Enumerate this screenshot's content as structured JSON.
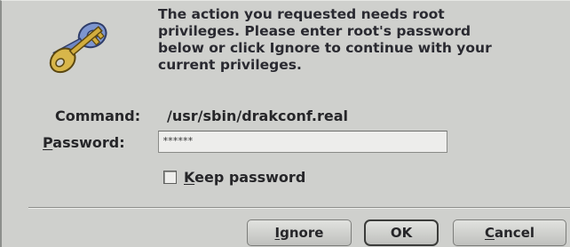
{
  "dialog": {
    "icon": "keys-icon",
    "message_lines": [
      "The action you requested needs root",
      "privileges. Please enter root's password",
      "below or click Ignore to continue with your",
      "current privileges."
    ],
    "command_label": "Command:",
    "command_value": "/usr/sbin/drakconf.real",
    "password_label_mnemonic": "P",
    "password_label_rest": "assword:",
    "password_value": "******",
    "keep_password_mnemonic": "K",
    "keep_password_rest": "eep password",
    "keep_password_checked": false
  },
  "buttons": {
    "ignore_mnemonic": "I",
    "ignore_rest": "gnore",
    "ok_label": "OK",
    "cancel_mnemonic": "C",
    "cancel_rest": "ancel"
  },
  "colors": {
    "background": "#cfd0cd",
    "key_gold": "#c9a63a",
    "key_blue": "#5a76b8"
  }
}
